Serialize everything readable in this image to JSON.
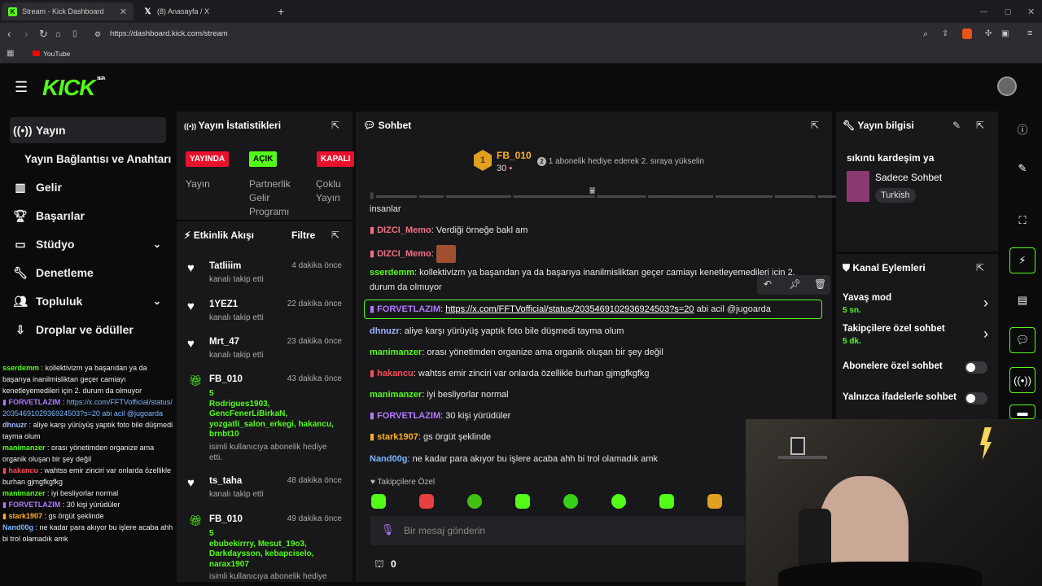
{
  "browser": {
    "tabs": [
      {
        "title": "Stream - Kick Dashboard",
        "active": true
      },
      {
        "title": "(8) Anasayfa / X",
        "active": false
      }
    ],
    "url": "https://dashboard.kick.com/stream",
    "bookmarks": [
      "YouTube"
    ]
  },
  "app": {
    "logo": "KICK",
    "logo_sup": "BETA",
    "accent": "#53fc18"
  },
  "sidebar": {
    "items": [
      {
        "label": "Yayın",
        "icon": "broadcast-icon",
        "active": true
      },
      {
        "label": "Yayın Bağlantısı ve Anahtarı",
        "icon": "",
        "active": false
      },
      {
        "label": "Gelir",
        "icon": "bar-chart-icon",
        "active": false
      },
      {
        "label": "Başarılar",
        "icon": "trophy-icon",
        "active": false
      },
      {
        "label": "Stüdyo",
        "icon": "studio-icon",
        "active": false,
        "expandable": true
      },
      {
        "label": "Denetleme",
        "icon": "wrench-icon",
        "active": false
      },
      {
        "label": "Topluluk",
        "icon": "people-icon",
        "active": false,
        "expandable": true
      },
      {
        "label": "Droplar ve ödüller",
        "icon": "drops-icon",
        "active": false
      }
    ]
  },
  "stats": {
    "title": "Yayın İstatistikleri",
    "badges": [
      {
        "label": "YAYINDA",
        "color": "#e8112d",
        "caption_lines": [
          "Yayın"
        ]
      },
      {
        "label": "AÇIK",
        "color": "#53fc18",
        "caption_lines": [
          "Partnerlik",
          "Gelir",
          "Programı"
        ]
      },
      {
        "label": "KAPALI",
        "color": "#e8112d",
        "caption_lines": [
          "Çoklu",
          "Yayın"
        ]
      }
    ]
  },
  "activity": {
    "title": "Etkinlik Akışı",
    "filter": "Filtre",
    "events": [
      {
        "type": "follow",
        "name": "Tatliiim",
        "time": "4 dakika önce",
        "sub": "kanalı takip etti"
      },
      {
        "type": "follow",
        "name": "1YEZ1",
        "time": "22 dakika önce",
        "sub": "kanalı takip etti"
      },
      {
        "type": "follow",
        "name": "Mrt_47",
        "time": "23 dakika önce",
        "sub": "kanalı takip etti"
      },
      {
        "type": "gift",
        "name": "FB_010",
        "time": "43 dakika önce",
        "count": "5",
        "gifted_lines": [
          "Rodrigues1903,",
          "GencFenerLiBirkaN,",
          "yozgatli_salon_erkegi, hakancu,",
          "brnbt10"
        ],
        "sub_lines": [
          "isimli kullanıcıya abonelik hediye",
          "etti."
        ]
      },
      {
        "type": "follow",
        "name": "ts_taha",
        "time": "48 dakika önce",
        "sub": "kanalı takip etti"
      },
      {
        "type": "gift",
        "name": "FB_010",
        "time": "49 dakika önce",
        "count": "5",
        "gifted_lines": [
          "ebubekirrry, Mesut_19o3,",
          "Darkdaysson, kebapciselo,",
          "narax1907"
        ],
        "sub_lines": [
          "isimli kullanıcıya abonelik hediye"
        ]
      }
    ]
  },
  "chat": {
    "title": "Sohbet",
    "leader": {
      "rank": "1",
      "name": "FB_010",
      "count": "30",
      "hint": "1 abonelik hediye ederek 2. sıraya yükselin"
    },
    "messages": [
      {
        "user": "",
        "color": "#e8e8e8",
        "text": "insanlar"
      },
      {
        "user": "DIZCI_Memo",
        "color": "#f07080",
        "text": "Verdiği örneğe bakl am"
      },
      {
        "user": "DIZCI_Memo",
        "color": "#f07080",
        "text": ""
      },
      {
        "user": "sserdemm",
        "color": "#53fc18",
        "text": "kollektivizm ya başarıdan ya da başarıya inanilmisliktan geçer camiayı kenetleyemedileri için 2."
      },
      {
        "user": "",
        "color": "#e8e8e8",
        "text": "durum da olmuyor"
      },
      {
        "user": "FORVETLAZIM",
        "color": "#b07aff",
        "text": "abi acil @jugoarda",
        "link": "https://x.com/FFTVofficial/status/2035469102936924503?s=20"
      },
      {
        "user": "dhnuzr",
        "color": "#9fb6ff",
        "text": "aliye karşı yürüyüş yaptık foto bile düşmedi tayma olum"
      },
      {
        "user": "manimanzer",
        "color": "#53fc18",
        "text": "orası yönetimden organize ama organik oluşan bir şey değil"
      },
      {
        "user": "hakancu",
        "color": "#ff4a5a",
        "text": "wahtss emir zinciri var onlarda özellikle burhan gjmgfkgfkg"
      },
      {
        "user": "manimanzer",
        "color": "#53fc18",
        "text": "iyi besliyorlar normal"
      },
      {
        "user": "FORVETLAZIM",
        "color": "#b07aff",
        "text": "30 kişi yürüdüler"
      },
      {
        "user": "stark1907",
        "color": "#ffb020",
        "text": "gs örgüt şeklinde"
      },
      {
        "user": "Nand00g",
        "color": "#7ab6ff",
        "text": "ne kadar para akıyor bu işlere acaba ahh bi trol olamadık amk"
      }
    ],
    "followers_only": "Takipçilere Özel",
    "input_placeholder": "Bir mesaj gönderin",
    "points": "0"
  },
  "stream_info": {
    "title": "Yayın bilgisi",
    "stream_title": "sıkıntı kardeşim ya",
    "category": "Sadece Sohbet",
    "language": "Turkish"
  },
  "channel_actions": {
    "title": "Kanal Eylemleri",
    "items": [
      {
        "label": "Yavaş mod",
        "value": "5 sn.",
        "type": "arrow"
      },
      {
        "label": "Takipçilere özel sohbet",
        "value": "5 dk.",
        "type": "arrow"
      },
      {
        "label": "Abonelere özel sohbet",
        "value": "",
        "type": "toggle"
      },
      {
        "label": "Yalnızca ifadelerle sohbet",
        "value": "",
        "type": "toggle"
      }
    ]
  },
  "overlay_chat": [
    {
      "user": "sserdemm",
      "color": "#53fc18",
      "text": "kollektivizm ya başarıdan ya da başarıya inanilmisliktan geçer camiayı kenetleyemedileri için 2. durum da olmuyor"
    },
    {
      "user": "FORVETLAZIM",
      "color": "#b07aff",
      "text": "https://x.com/FFTVofficial/status/2035469102936924503?s=20 abi acil @jugoarda"
    },
    {
      "user": "dhnuzr",
      "color": "#9fb6ff",
      "text": "aliye karşı yürüyüş yaptık foto bile düşmedi tayma olum"
    },
    {
      "user": "manimanzer",
      "color": "#53fc18",
      "text": "orası yönetimden organize ama organik oluşan bir şey değil"
    },
    {
      "user": "hakancu",
      "color": "#ff4a5a",
      "text": "wahtss emir zinciri var onlarda özellikle burhan gjmgfkgfkg"
    },
    {
      "user": "manimanzer",
      "color": "#53fc18",
      "text": "iyi besliyorlar normal"
    },
    {
      "user": "FORVETLAZIM",
      "color": "#b07aff",
      "text": "30 kişi yürüdüler"
    },
    {
      "user": "stark1907",
      "color": "#ffb020",
      "text": "gs örgüt şeklinde"
    },
    {
      "user": "Nand00g",
      "color": "#7ab6ff",
      "text": "ne kadar para akıyor bu işlere acaba ahh bi trol olamadık amk"
    }
  ]
}
